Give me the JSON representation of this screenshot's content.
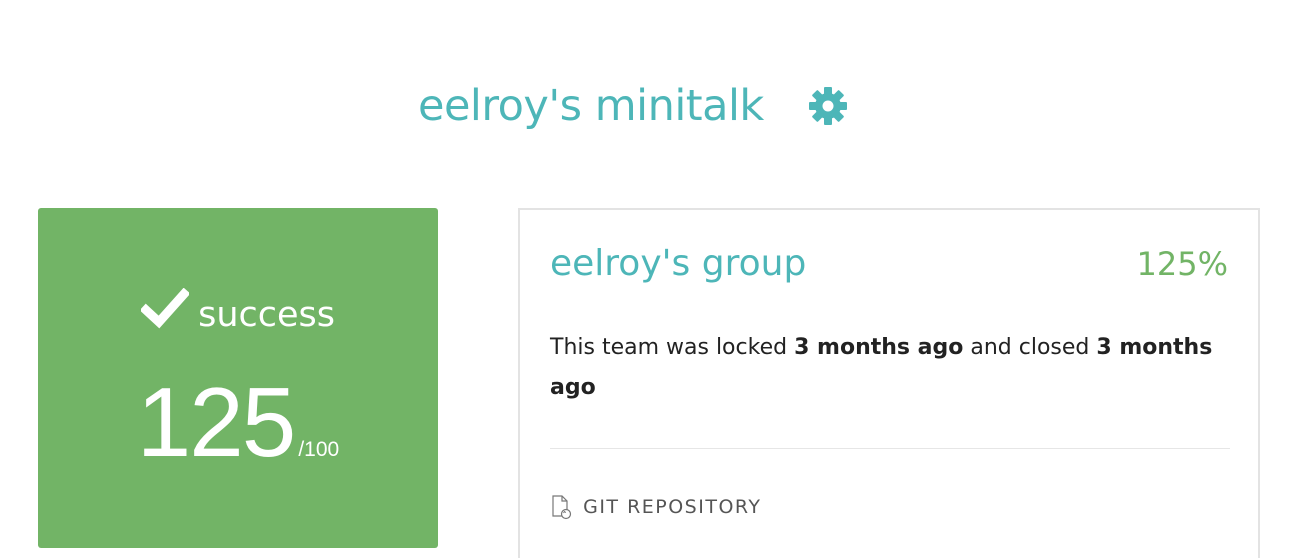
{
  "header": {
    "title": "eelroy's minitalk",
    "settings_icon": "gear-icon"
  },
  "score_card": {
    "status_icon": "check-icon",
    "status": "success",
    "score": "125",
    "max": "/100",
    "background_color": "#72b466"
  },
  "detail": {
    "group_name": "eelroy's group",
    "percent": "125%",
    "lock_prefix": "This team was locked ",
    "locked_time": "3 months ago",
    "lock_middle": " and closed ",
    "closed_time": "3 months ago",
    "repo_icon": "file-sync-icon",
    "repo_label": "GIT REPOSITORY"
  },
  "colors": {
    "accent": "#4db6b8",
    "success": "#72b466",
    "text": "#222222",
    "border": "#e3e3e3"
  }
}
